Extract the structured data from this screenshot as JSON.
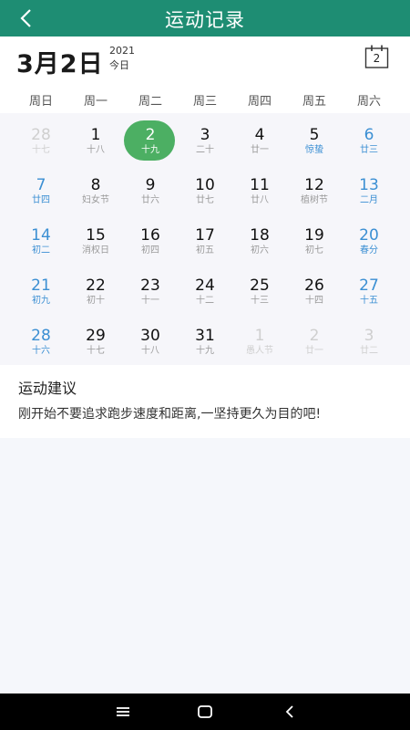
{
  "header": {
    "title": "运动记录"
  },
  "date_header": {
    "big_date": "3月2日",
    "year": "2021",
    "today_label": "今日",
    "calendar_icon_day": "2"
  },
  "weekdays": [
    "周日",
    "周一",
    "周二",
    "周三",
    "周四",
    "周五",
    "周六"
  ],
  "calendar": {
    "weeks": [
      [
        {
          "day": "28",
          "sub": "十七",
          "state": "other"
        },
        {
          "day": "1",
          "sub": "十八",
          "state": "normal"
        },
        {
          "day": "2",
          "sub": "十九",
          "state": "selected"
        },
        {
          "day": "3",
          "sub": "二十",
          "state": "normal"
        },
        {
          "day": "4",
          "sub": "廿一",
          "state": "normal"
        },
        {
          "day": "5",
          "sub": "惊蛰",
          "state": "festival"
        },
        {
          "day": "6",
          "sub": "廿三",
          "state": "weekend"
        }
      ],
      [
        {
          "day": "7",
          "sub": "廿四",
          "state": "weekend"
        },
        {
          "day": "8",
          "sub": "妇女节",
          "state": "normal"
        },
        {
          "day": "9",
          "sub": "廿六",
          "state": "normal"
        },
        {
          "day": "10",
          "sub": "廿七",
          "state": "normal"
        },
        {
          "day": "11",
          "sub": "廿八",
          "state": "normal"
        },
        {
          "day": "12",
          "sub": "植树节",
          "state": "normal"
        },
        {
          "day": "13",
          "sub": "二月",
          "state": "weekend"
        }
      ],
      [
        {
          "day": "14",
          "sub": "初二",
          "state": "weekend"
        },
        {
          "day": "15",
          "sub": "消权日",
          "state": "normal"
        },
        {
          "day": "16",
          "sub": "初四",
          "state": "normal"
        },
        {
          "day": "17",
          "sub": "初五",
          "state": "normal"
        },
        {
          "day": "18",
          "sub": "初六",
          "state": "normal"
        },
        {
          "day": "19",
          "sub": "初七",
          "state": "normal"
        },
        {
          "day": "20",
          "sub": "春分",
          "state": "weekend"
        }
      ],
      [
        {
          "day": "21",
          "sub": "初九",
          "state": "weekend"
        },
        {
          "day": "22",
          "sub": "初十",
          "state": "normal"
        },
        {
          "day": "23",
          "sub": "十一",
          "state": "normal"
        },
        {
          "day": "24",
          "sub": "十二",
          "state": "normal"
        },
        {
          "day": "25",
          "sub": "十三",
          "state": "normal"
        },
        {
          "day": "26",
          "sub": "十四",
          "state": "normal"
        },
        {
          "day": "27",
          "sub": "十五",
          "state": "weekend"
        }
      ],
      [
        {
          "day": "28",
          "sub": "十六",
          "state": "weekend"
        },
        {
          "day": "29",
          "sub": "十七",
          "state": "normal"
        },
        {
          "day": "30",
          "sub": "十八",
          "state": "normal"
        },
        {
          "day": "31",
          "sub": "十九",
          "state": "normal"
        },
        {
          "day": "1",
          "sub": "愚人节",
          "state": "other"
        },
        {
          "day": "2",
          "sub": "廿一",
          "state": "other"
        },
        {
          "day": "3",
          "sub": "廿二",
          "state": "other"
        }
      ]
    ]
  },
  "advice": {
    "heading": "运动建议",
    "text": "刚开始不要追求跑步速度和距离,一坚持更久为目的吧!"
  },
  "colors": {
    "header_bg": "#1e8d73",
    "selected": "#4caf63",
    "weekend": "#3b8fd3"
  },
  "icons": {
    "back": "chevron-left-icon",
    "calendar": "calendar-icon",
    "menu": "menu-icon",
    "home": "home-icon",
    "nav_back": "nav-back-icon"
  }
}
